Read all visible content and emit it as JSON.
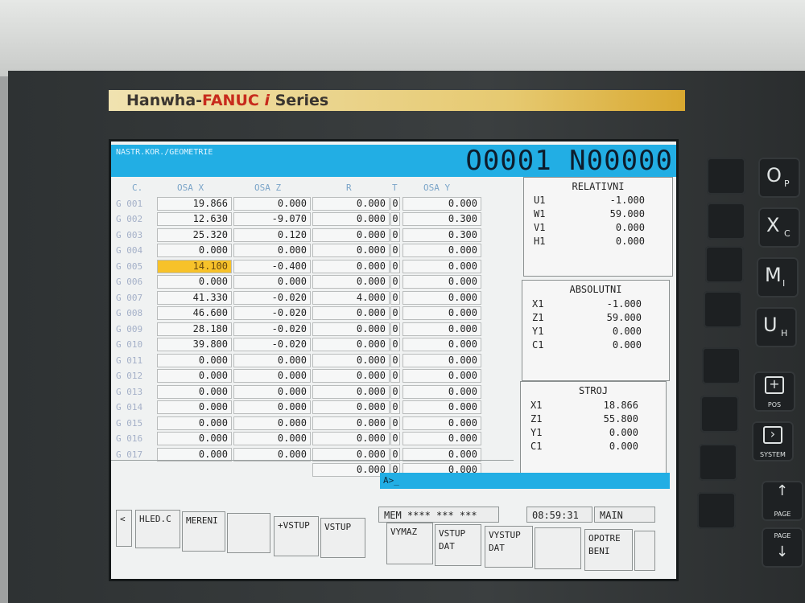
{
  "brand": {
    "part1": "Hanwha-",
    "part2": "FANUC ",
    "part3": "i",
    "part4": " Series"
  },
  "header": {
    "title": "NASTR.KOR./GEOMETRIE",
    "program": "O0001 N00000"
  },
  "table": {
    "columns": [
      "C.",
      "OSA X",
      "OSA Z",
      "R",
      "T",
      "OSA Y"
    ],
    "rows": [
      {
        "id": "G 001",
        "x": "19.866",
        "z": "0.000",
        "r": "0.000",
        "t": "0",
        "y": "0.000"
      },
      {
        "id": "G 002",
        "x": "12.630",
        "z": "-9.070",
        "r": "0.000",
        "t": "0",
        "y": "0.300"
      },
      {
        "id": "G 003",
        "x": "25.320",
        "z": "0.120",
        "r": "0.000",
        "t": "0",
        "y": "0.300"
      },
      {
        "id": "G 004",
        "x": "0.000",
        "z": "0.000",
        "r": "0.000",
        "t": "0",
        "y": "0.000"
      },
      {
        "id": "G 005",
        "x": "14.100",
        "z": "-0.400",
        "r": "0.000",
        "t": "0",
        "y": "0.000"
      },
      {
        "id": "G 006",
        "x": "0.000",
        "z": "0.000",
        "r": "0.000",
        "t": "0",
        "y": "0.000"
      },
      {
        "id": "G 007",
        "x": "41.330",
        "z": "-0.020",
        "r": "4.000",
        "t": "0",
        "y": "0.000"
      },
      {
        "id": "G 008",
        "x": "46.600",
        "z": "-0.020",
        "r": "0.000",
        "t": "0",
        "y": "0.000"
      },
      {
        "id": "G 009",
        "x": "28.180",
        "z": "-0.020",
        "r": "0.000",
        "t": "0",
        "y": "0.000"
      },
      {
        "id": "G 010",
        "x": "39.800",
        "z": "-0.020",
        "r": "0.000",
        "t": "0",
        "y": "0.000"
      },
      {
        "id": "G 011",
        "x": "0.000",
        "z": "0.000",
        "r": "0.000",
        "t": "0",
        "y": "0.000"
      },
      {
        "id": "G 012",
        "x": "0.000",
        "z": "0.000",
        "r": "0.000",
        "t": "0",
        "y": "0.000"
      },
      {
        "id": "G 013",
        "x": "0.000",
        "z": "0.000",
        "r": "0.000",
        "t": "0",
        "y": "0.000"
      },
      {
        "id": "G 014",
        "x": "0.000",
        "z": "0.000",
        "r": "0.000",
        "t": "0",
        "y": "0.000"
      },
      {
        "id": "G 015",
        "x": "0.000",
        "z": "0.000",
        "r": "0.000",
        "t": "0",
        "y": "0.000"
      },
      {
        "id": "G 016",
        "x": "0.000",
        "z": "0.000",
        "r": "0.000",
        "t": "0",
        "y": "0.000"
      },
      {
        "id": "G 017",
        "x": "0.000",
        "z": "0.000",
        "r": "0.000",
        "t": "0",
        "y": "0.000"
      },
      {
        "id": "",
        "x": "",
        "z": "",
        "r": "0.000",
        "t": "0",
        "y": "0.000"
      }
    ]
  },
  "relativni": {
    "title": "RELATIVNI",
    "rows": [
      {
        "n": "U1",
        "v": "-1.000"
      },
      {
        "n": "W1",
        "v": "59.000"
      },
      {
        "n": "V1",
        "v": "0.000"
      },
      {
        "n": "H1",
        "v": "0.000"
      }
    ]
  },
  "absolutni": {
    "title": "ABSOLUTNI",
    "rows": [
      {
        "n": "X1",
        "v": "-1.000"
      },
      {
        "n": "Z1",
        "v": "59.000"
      },
      {
        "n": "Y1",
        "v": "0.000"
      },
      {
        "n": "C1",
        "v": "0.000"
      }
    ]
  },
  "stroj": {
    "title": "STROJ",
    "rows": [
      {
        "n": "X1",
        "v": "18.866"
      },
      {
        "n": "Z1",
        "v": "55.800"
      },
      {
        "n": "Y1",
        "v": "0.000"
      },
      {
        "n": "C1",
        "v": "0.000"
      }
    ]
  },
  "command_line": "A>_",
  "status": {
    "mode": "MEM  **** ***  ***",
    "time": "08:59:31",
    "screen": "MAIN"
  },
  "softkeys": {
    "back": "<",
    "hled": "HLED.C",
    "mereni": "MERENI",
    "plus_vstup": "+VSTUP",
    "vstup": "VSTUP",
    "vymaz": "VYMAZ",
    "vstup_dat_1": "VSTUP",
    "vstup_dat_2": "DAT",
    "vystup_dat_1": "VYSTUP",
    "vystup_dat_2": "DAT",
    "opotre_1": "OPOTRE",
    "opotre_2": "BENI"
  },
  "keys": {
    "o": {
      "big": "O",
      "sub": "P"
    },
    "x": {
      "big": "X",
      "sub": "C"
    },
    "m": {
      "big": "M",
      "sub": "I"
    },
    "u": {
      "big": "U",
      "sub": "H"
    },
    "pos": "POS",
    "system": "SYSTEM",
    "page_up": "PAGE",
    "page_down": "PAGE"
  },
  "selected_row_index": 4
}
